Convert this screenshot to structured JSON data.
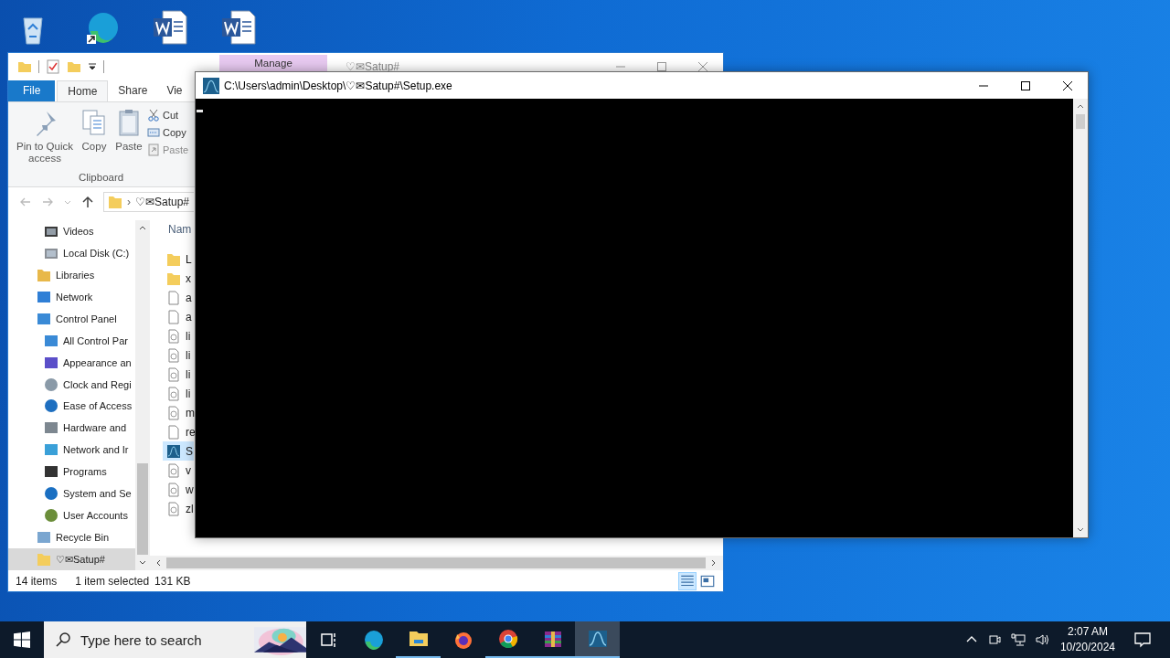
{
  "desktop_icons": [
    {
      "kind": "recycle"
    },
    {
      "kind": "edge"
    },
    {
      "kind": "word"
    },
    {
      "kind": "word"
    }
  ],
  "explorer": {
    "title": "♡✉Satup#",
    "context_tab": "Manage",
    "ribbon_tabs": [
      {
        "label": "File",
        "kind": "file",
        "selected": false
      },
      {
        "label": "Home",
        "kind": "tab",
        "selected": true
      },
      {
        "label": "Share",
        "kind": "tab",
        "selected": false
      },
      {
        "label": "Vie",
        "kind": "tab",
        "selected": false
      }
    ],
    "clipboard_large": [
      {
        "label": "Pin to Quick access",
        "kind": "pin"
      },
      {
        "label": "Copy",
        "kind": "copy"
      },
      {
        "label": "Paste",
        "kind": "paste"
      }
    ],
    "clipboard_small": [
      {
        "label": "Cut",
        "kind": "cut",
        "disabled": false
      },
      {
        "label": "Copy",
        "kind": "copypath",
        "disabled": false
      },
      {
        "label": "Paste",
        "kind": "shortcut",
        "disabled": true
      }
    ],
    "clipboard_group": "Clipboard",
    "address": {
      "separator": "›",
      "path": "♡✉Satup#"
    },
    "this_pc_children": [
      {
        "label": "Videos",
        "kind": "videos",
        "selected": false
      },
      {
        "label": "Local Disk (C:)",
        "kind": "disk",
        "selected": false
      }
    ],
    "nav_tree": [
      {
        "label": "Libraries",
        "kind": "libraries",
        "selected": false
      },
      {
        "label": "Network",
        "kind": "network",
        "selected": false
      },
      {
        "label": "Control Panel",
        "kind": "control",
        "selected": false,
        "children": [
          {
            "label": "All Control Par",
            "kind": "control",
            "selected": false
          },
          {
            "label": "Appearance an",
            "kind": "appearance",
            "selected": false
          },
          {
            "label": "Clock and Regi",
            "kind": "clock",
            "selected": false
          },
          {
            "label": "Ease of Access",
            "kind": "access",
            "selected": false
          },
          {
            "label": "Hardware and",
            "kind": "hardware",
            "selected": false
          },
          {
            "label": "Network and Ir",
            "kind": "netcp",
            "selected": false
          },
          {
            "label": "Programs",
            "kind": "programs",
            "selected": false
          },
          {
            "label": "System and Se",
            "kind": "system",
            "selected": false
          },
          {
            "label": "User Accounts",
            "kind": "users",
            "selected": false
          }
        ]
      },
      {
        "label": "Recycle Bin",
        "kind": "recycle",
        "selected": false
      },
      {
        "label": "♡✉Satup#",
        "kind": "folder",
        "selected": true
      }
    ],
    "files_header": "Nam",
    "files": [
      {
        "name": "L",
        "kind": "folder",
        "selected": false
      },
      {
        "name": "x",
        "kind": "folder",
        "selected": false
      },
      {
        "name": "a",
        "kind": "file",
        "selected": false
      },
      {
        "name": "a",
        "kind": "file",
        "selected": false
      },
      {
        "name": "li",
        "kind": "dll",
        "selected": false
      },
      {
        "name": "li",
        "kind": "dll",
        "selected": false
      },
      {
        "name": "li",
        "kind": "dll",
        "selected": false
      },
      {
        "name": "li",
        "kind": "dll",
        "selected": false
      },
      {
        "name": "m",
        "kind": "dll",
        "selected": false
      },
      {
        "name": "re",
        "kind": "file",
        "selected": false
      },
      {
        "name": "S",
        "kind": "app",
        "selected": true
      },
      {
        "name": "v",
        "kind": "dll",
        "selected": false
      },
      {
        "name": "w",
        "kind": "dll",
        "selected": false
      },
      {
        "name": "zl",
        "kind": "dll",
        "selected": false
      }
    ],
    "status": [
      "14 items",
      "1 item selected",
      "131 KB"
    ]
  },
  "console": {
    "title": "C:\\Users\\admin\\Desktop\\♡✉Satup#\\Setup.exe"
  },
  "taskbar": {
    "search_placeholder": "Type here to search",
    "apps": [
      {
        "kind": "taskview",
        "running": false,
        "selected": false
      },
      {
        "kind": "edge",
        "running": false,
        "selected": false
      },
      {
        "kind": "explorer",
        "running": true,
        "selected": false
      },
      {
        "kind": "firefox",
        "running": false,
        "selected": false
      },
      {
        "kind": "chrome",
        "running": true,
        "selected": false
      },
      {
        "kind": "winrar",
        "running": true,
        "selected": false
      },
      {
        "kind": "app",
        "running": true,
        "selected": true
      }
    ],
    "time": "2:07 AM",
    "date": "10/20/2024"
  }
}
